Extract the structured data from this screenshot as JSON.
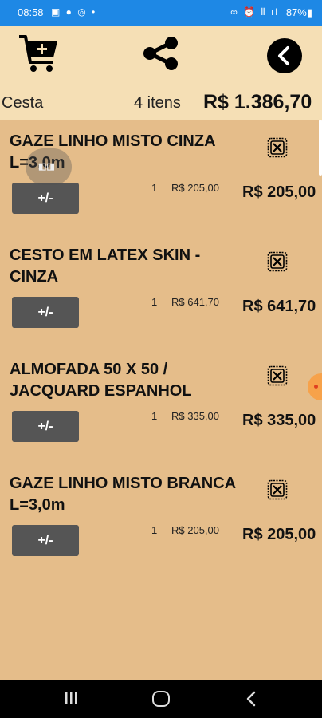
{
  "status": {
    "time": "08:58",
    "left_icons": "▣ ● ◎ •",
    "right_icons": "∞ ⏰ ⦀ ıl",
    "battery": "87%▮"
  },
  "header": {
    "cart_icon": "cart-add-icon",
    "share_icon": "share-icon",
    "back_icon": "chevron-left-icon",
    "title": "Cesta",
    "items_count": "4 itens",
    "total": "R$ 1.386,70"
  },
  "items": [
    {
      "name": "GAZE LINHO MISTO CINZA L=3,0m",
      "qty_button": "+/-",
      "qty": "1",
      "unit_price": "R$ 205,00",
      "line_total": "R$ 205,00"
    },
    {
      "name": "CESTO EM LATEX SKIN - CINZA",
      "qty_button": "+/-",
      "qty": "1",
      "unit_price": "R$ 641,70",
      "line_total": "R$ 641,70"
    },
    {
      "name": "ALMOFADA 50 X 50 / JACQUARD ESPANHOL",
      "qty_button": "+/-",
      "qty": "1",
      "unit_price": "R$ 335,00",
      "line_total": "R$ 335,00"
    },
    {
      "name": "GAZE LINHO MISTO BRANCA L=3,0m",
      "qty_button": "+/-",
      "qty": "1",
      "unit_price": "R$ 205,00",
      "line_total": "R$ 205,00"
    }
  ],
  "floating_bubble_text": "◧◨",
  "colors": {
    "status_bar": "#1E88E5",
    "header_bg": "#F5DFB5",
    "list_bg": "#E5BD8A",
    "button_bg": "#555555"
  }
}
